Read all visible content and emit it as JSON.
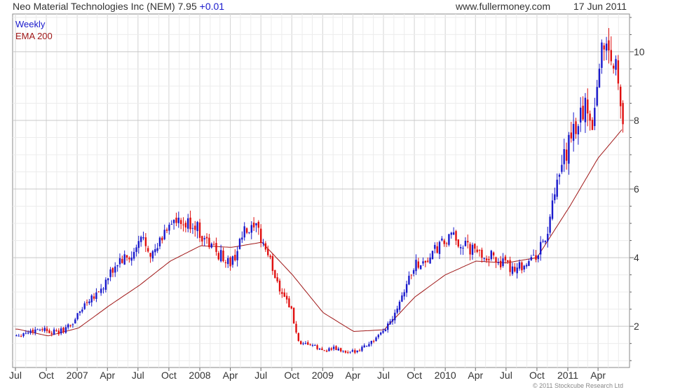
{
  "header": {
    "title": "Neo Material Technologies Inc (NEM) 7.95",
    "change": "+0.01",
    "site": "www.fullermoney.com",
    "date": "17 Jun 2011"
  },
  "footer": "© 2011 Stockcube Research Ltd",
  "chart_data": {
    "type": "candlestick",
    "legend": [
      "Weekly",
      "EMA 200"
    ],
    "legend_position": "top-left",
    "grid": true,
    "colors": {
      "up": "#1a1acc",
      "down": "#e01010",
      "ema": "#a01818",
      "grid": "#d9d9d9"
    },
    "xlabels": [
      "Jul",
      "Oct",
      "2007",
      "Apr",
      "Jul",
      "Oct",
      "2008",
      "Apr",
      "Jul",
      "Oct",
      "2009",
      "Apr",
      "Jul",
      "Oct",
      "2010",
      "Apr",
      "Jul",
      "Oct",
      "2011",
      "Apr"
    ],
    "x_range": [
      "2006-07-01",
      "2011-06-17"
    ],
    "ylim": [
      0.8,
      11.1
    ],
    "yticks": [
      2,
      4,
      6,
      8,
      10
    ],
    "price_keypoints": [
      [
        "2006-07-07",
        1.75
      ],
      [
        "2006-09-15",
        1.95
      ],
      [
        "2006-11-03",
        1.8
      ],
      [
        "2006-12-15",
        2.05
      ],
      [
        "2007-02-02",
        2.8
      ],
      [
        "2007-03-16",
        3.1
      ],
      [
        "2007-05-04",
        3.9
      ],
      [
        "2007-06-15",
        4.0
      ],
      [
        "2007-07-13",
        4.6
      ],
      [
        "2007-08-17",
        4.05
      ],
      [
        "2007-10-05",
        5.1
      ],
      [
        "2007-11-09",
        4.9
      ],
      [
        "2007-12-14",
        5.0
      ],
      [
        "2008-01-18",
        4.5
      ],
      [
        "2008-02-29",
        4.1
      ],
      [
        "2008-04-04",
        3.8
      ],
      [
        "2008-05-09",
        4.7
      ],
      [
        "2008-06-20",
        4.8
      ],
      [
        "2008-07-18",
        4.2
      ],
      [
        "2008-08-22",
        3.2
      ],
      [
        "2008-09-26",
        2.6
      ],
      [
        "2008-10-24",
        1.4
      ],
      [
        "2008-11-21",
        1.5
      ],
      [
        "2008-12-26",
        1.3
      ],
      [
        "2009-02-06",
        1.35
      ],
      [
        "2009-03-20",
        1.2
      ],
      [
        "2009-05-01",
        1.4
      ],
      [
        "2009-06-19",
        1.7
      ],
      [
        "2009-07-24",
        2.2
      ],
      [
        "2009-08-28",
        3.0
      ],
      [
        "2009-10-02",
        3.8
      ],
      [
        "2009-11-06",
        3.9
      ],
      [
        "2009-12-11",
        4.3
      ],
      [
        "2010-01-22",
        4.6
      ],
      [
        "2010-03-05",
        4.3
      ],
      [
        "2010-04-16",
        4.1
      ],
      [
        "2010-05-28",
        4.0
      ],
      [
        "2010-07-09",
        3.7
      ],
      [
        "2010-08-20",
        3.8
      ],
      [
        "2010-09-24",
        4.0
      ],
      [
        "2010-10-29",
        4.6
      ],
      [
        "2010-11-26",
        5.9
      ],
      [
        "2010-12-24",
        7.0
      ],
      [
        "2011-01-21",
        7.7
      ],
      [
        "2011-02-18",
        8.4
      ],
      [
        "2011-03-18",
        8.0
      ],
      [
        "2011-04-01",
        9.3
      ],
      [
        "2011-04-15",
        10.4
      ],
      [
        "2011-05-06",
        10.0
      ],
      [
        "2011-05-27",
        9.5
      ],
      [
        "2011-06-10",
        8.5
      ],
      [
        "2011-06-17",
        7.95
      ]
    ],
    "ema_keypoints": [
      [
        "2006-07-07",
        1.92
      ],
      [
        "2006-10-06",
        1.72
      ],
      [
        "2007-01-05",
        1.95
      ],
      [
        "2007-04-06",
        2.6
      ],
      [
        "2007-07-06",
        3.2
      ],
      [
        "2007-10-05",
        3.9
      ],
      [
        "2008-01-04",
        4.35
      ],
      [
        "2008-04-04",
        4.3
      ],
      [
        "2008-07-04",
        4.45
      ],
      [
        "2008-10-03",
        3.5
      ],
      [
        "2009-01-02",
        2.4
      ],
      [
        "2009-04-03",
        1.85
      ],
      [
        "2009-07-03",
        1.9
      ],
      [
        "2009-10-02",
        2.85
      ],
      [
        "2010-01-01",
        3.5
      ],
      [
        "2010-04-02",
        3.9
      ],
      [
        "2010-07-02",
        3.85
      ],
      [
        "2010-10-01",
        4.0
      ],
      [
        "2011-01-07",
        5.5
      ],
      [
        "2011-04-01",
        6.9
      ],
      [
        "2011-06-17",
        7.8
      ]
    ]
  }
}
